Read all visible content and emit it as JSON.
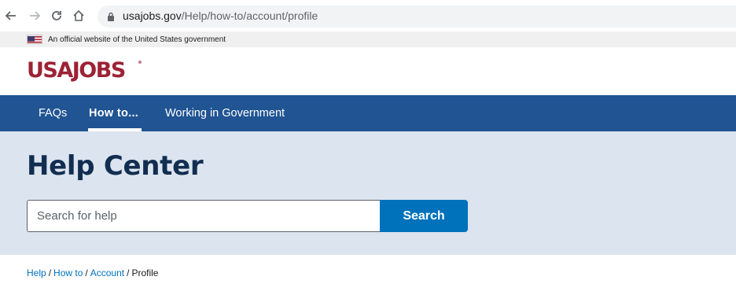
{
  "browser": {
    "url_host": "usajobs.gov",
    "url_path": "/Help/how-to/account/profile"
  },
  "gov_banner": {
    "text": "An official website of the United States government"
  },
  "logo": {
    "text": "USAJOBS"
  },
  "nav": {
    "items": [
      {
        "label": "FAQs"
      },
      {
        "label": "How to..."
      },
      {
        "label": "Working in Government"
      }
    ]
  },
  "hero": {
    "title": "Help Center",
    "search_placeholder": "Search for help",
    "search_button": "Search"
  },
  "breadcrumb": {
    "items": [
      {
        "label": "Help"
      },
      {
        "label": "How to"
      },
      {
        "label": "Account"
      },
      {
        "label": "Profile"
      }
    ]
  },
  "colors": {
    "brand_red": "#9d2235",
    "nav_blue": "#205493",
    "hero_bg": "#dce4ef",
    "title_navy": "#112e51",
    "button_blue": "#0071bb"
  }
}
